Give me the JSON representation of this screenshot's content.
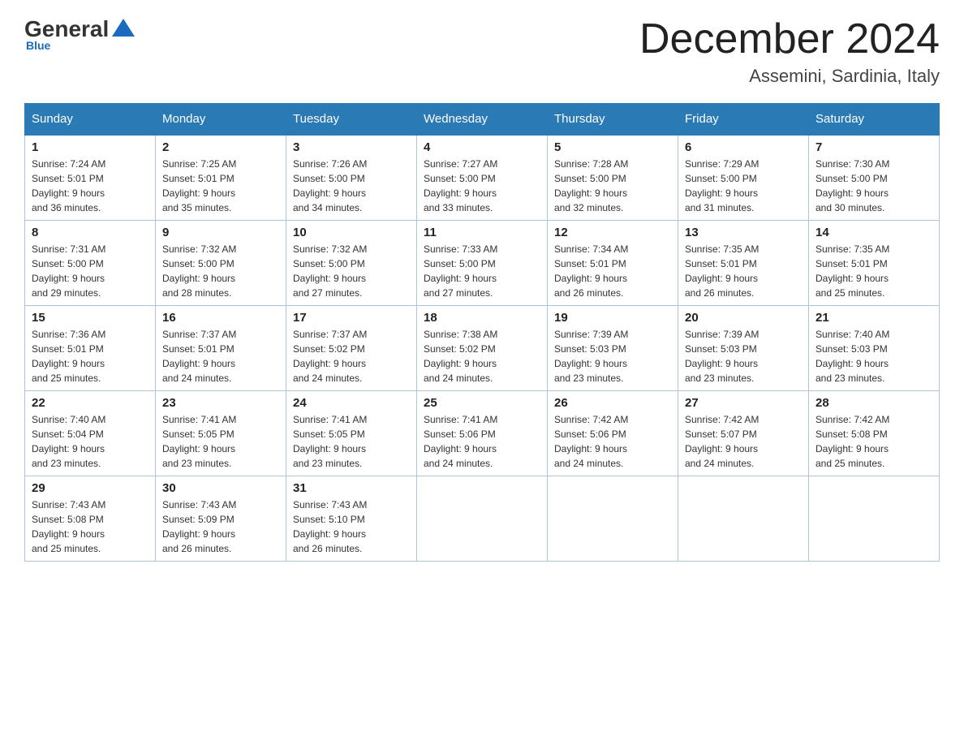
{
  "logo": {
    "general": "General",
    "blue": "Blue",
    "sub": "Blue"
  },
  "title": "December 2024",
  "location": "Assemini, Sardinia, Italy",
  "days_of_week": [
    "Sunday",
    "Monday",
    "Tuesday",
    "Wednesday",
    "Thursday",
    "Friday",
    "Saturday"
  ],
  "weeks": [
    [
      {
        "day": "1",
        "sunrise": "7:24 AM",
        "sunset": "5:01 PM",
        "daylight": "9 hours and 36 minutes."
      },
      {
        "day": "2",
        "sunrise": "7:25 AM",
        "sunset": "5:01 PM",
        "daylight": "9 hours and 35 minutes."
      },
      {
        "day": "3",
        "sunrise": "7:26 AM",
        "sunset": "5:00 PM",
        "daylight": "9 hours and 34 minutes."
      },
      {
        "day": "4",
        "sunrise": "7:27 AM",
        "sunset": "5:00 PM",
        "daylight": "9 hours and 33 minutes."
      },
      {
        "day": "5",
        "sunrise": "7:28 AM",
        "sunset": "5:00 PM",
        "daylight": "9 hours and 32 minutes."
      },
      {
        "day": "6",
        "sunrise": "7:29 AM",
        "sunset": "5:00 PM",
        "daylight": "9 hours and 31 minutes."
      },
      {
        "day": "7",
        "sunrise": "7:30 AM",
        "sunset": "5:00 PM",
        "daylight": "9 hours and 30 minutes."
      }
    ],
    [
      {
        "day": "8",
        "sunrise": "7:31 AM",
        "sunset": "5:00 PM",
        "daylight": "9 hours and 29 minutes."
      },
      {
        "day": "9",
        "sunrise": "7:32 AM",
        "sunset": "5:00 PM",
        "daylight": "9 hours and 28 minutes."
      },
      {
        "day": "10",
        "sunrise": "7:32 AM",
        "sunset": "5:00 PM",
        "daylight": "9 hours and 27 minutes."
      },
      {
        "day": "11",
        "sunrise": "7:33 AM",
        "sunset": "5:00 PM",
        "daylight": "9 hours and 27 minutes."
      },
      {
        "day": "12",
        "sunrise": "7:34 AM",
        "sunset": "5:01 PM",
        "daylight": "9 hours and 26 minutes."
      },
      {
        "day": "13",
        "sunrise": "7:35 AM",
        "sunset": "5:01 PM",
        "daylight": "9 hours and 26 minutes."
      },
      {
        "day": "14",
        "sunrise": "7:35 AM",
        "sunset": "5:01 PM",
        "daylight": "9 hours and 25 minutes."
      }
    ],
    [
      {
        "day": "15",
        "sunrise": "7:36 AM",
        "sunset": "5:01 PM",
        "daylight": "9 hours and 25 minutes."
      },
      {
        "day": "16",
        "sunrise": "7:37 AM",
        "sunset": "5:01 PM",
        "daylight": "9 hours and 24 minutes."
      },
      {
        "day": "17",
        "sunrise": "7:37 AM",
        "sunset": "5:02 PM",
        "daylight": "9 hours and 24 minutes."
      },
      {
        "day": "18",
        "sunrise": "7:38 AM",
        "sunset": "5:02 PM",
        "daylight": "9 hours and 24 minutes."
      },
      {
        "day": "19",
        "sunrise": "7:39 AM",
        "sunset": "5:03 PM",
        "daylight": "9 hours and 23 minutes."
      },
      {
        "day": "20",
        "sunrise": "7:39 AM",
        "sunset": "5:03 PM",
        "daylight": "9 hours and 23 minutes."
      },
      {
        "day": "21",
        "sunrise": "7:40 AM",
        "sunset": "5:03 PM",
        "daylight": "9 hours and 23 minutes."
      }
    ],
    [
      {
        "day": "22",
        "sunrise": "7:40 AM",
        "sunset": "5:04 PM",
        "daylight": "9 hours and 23 minutes."
      },
      {
        "day": "23",
        "sunrise": "7:41 AM",
        "sunset": "5:05 PM",
        "daylight": "9 hours and 23 minutes."
      },
      {
        "day": "24",
        "sunrise": "7:41 AM",
        "sunset": "5:05 PM",
        "daylight": "9 hours and 23 minutes."
      },
      {
        "day": "25",
        "sunrise": "7:41 AM",
        "sunset": "5:06 PM",
        "daylight": "9 hours and 24 minutes."
      },
      {
        "day": "26",
        "sunrise": "7:42 AM",
        "sunset": "5:06 PM",
        "daylight": "9 hours and 24 minutes."
      },
      {
        "day": "27",
        "sunrise": "7:42 AM",
        "sunset": "5:07 PM",
        "daylight": "9 hours and 24 minutes."
      },
      {
        "day": "28",
        "sunrise": "7:42 AM",
        "sunset": "5:08 PM",
        "daylight": "9 hours and 25 minutes."
      }
    ],
    [
      {
        "day": "29",
        "sunrise": "7:43 AM",
        "sunset": "5:08 PM",
        "daylight": "9 hours and 25 minutes."
      },
      {
        "day": "30",
        "sunrise": "7:43 AM",
        "sunset": "5:09 PM",
        "daylight": "9 hours and 26 minutes."
      },
      {
        "day": "31",
        "sunrise": "7:43 AM",
        "sunset": "5:10 PM",
        "daylight": "9 hours and 26 minutes."
      },
      null,
      null,
      null,
      null
    ]
  ],
  "labels": {
    "sunrise": "Sunrise:",
    "sunset": "Sunset:",
    "daylight": "Daylight:"
  }
}
